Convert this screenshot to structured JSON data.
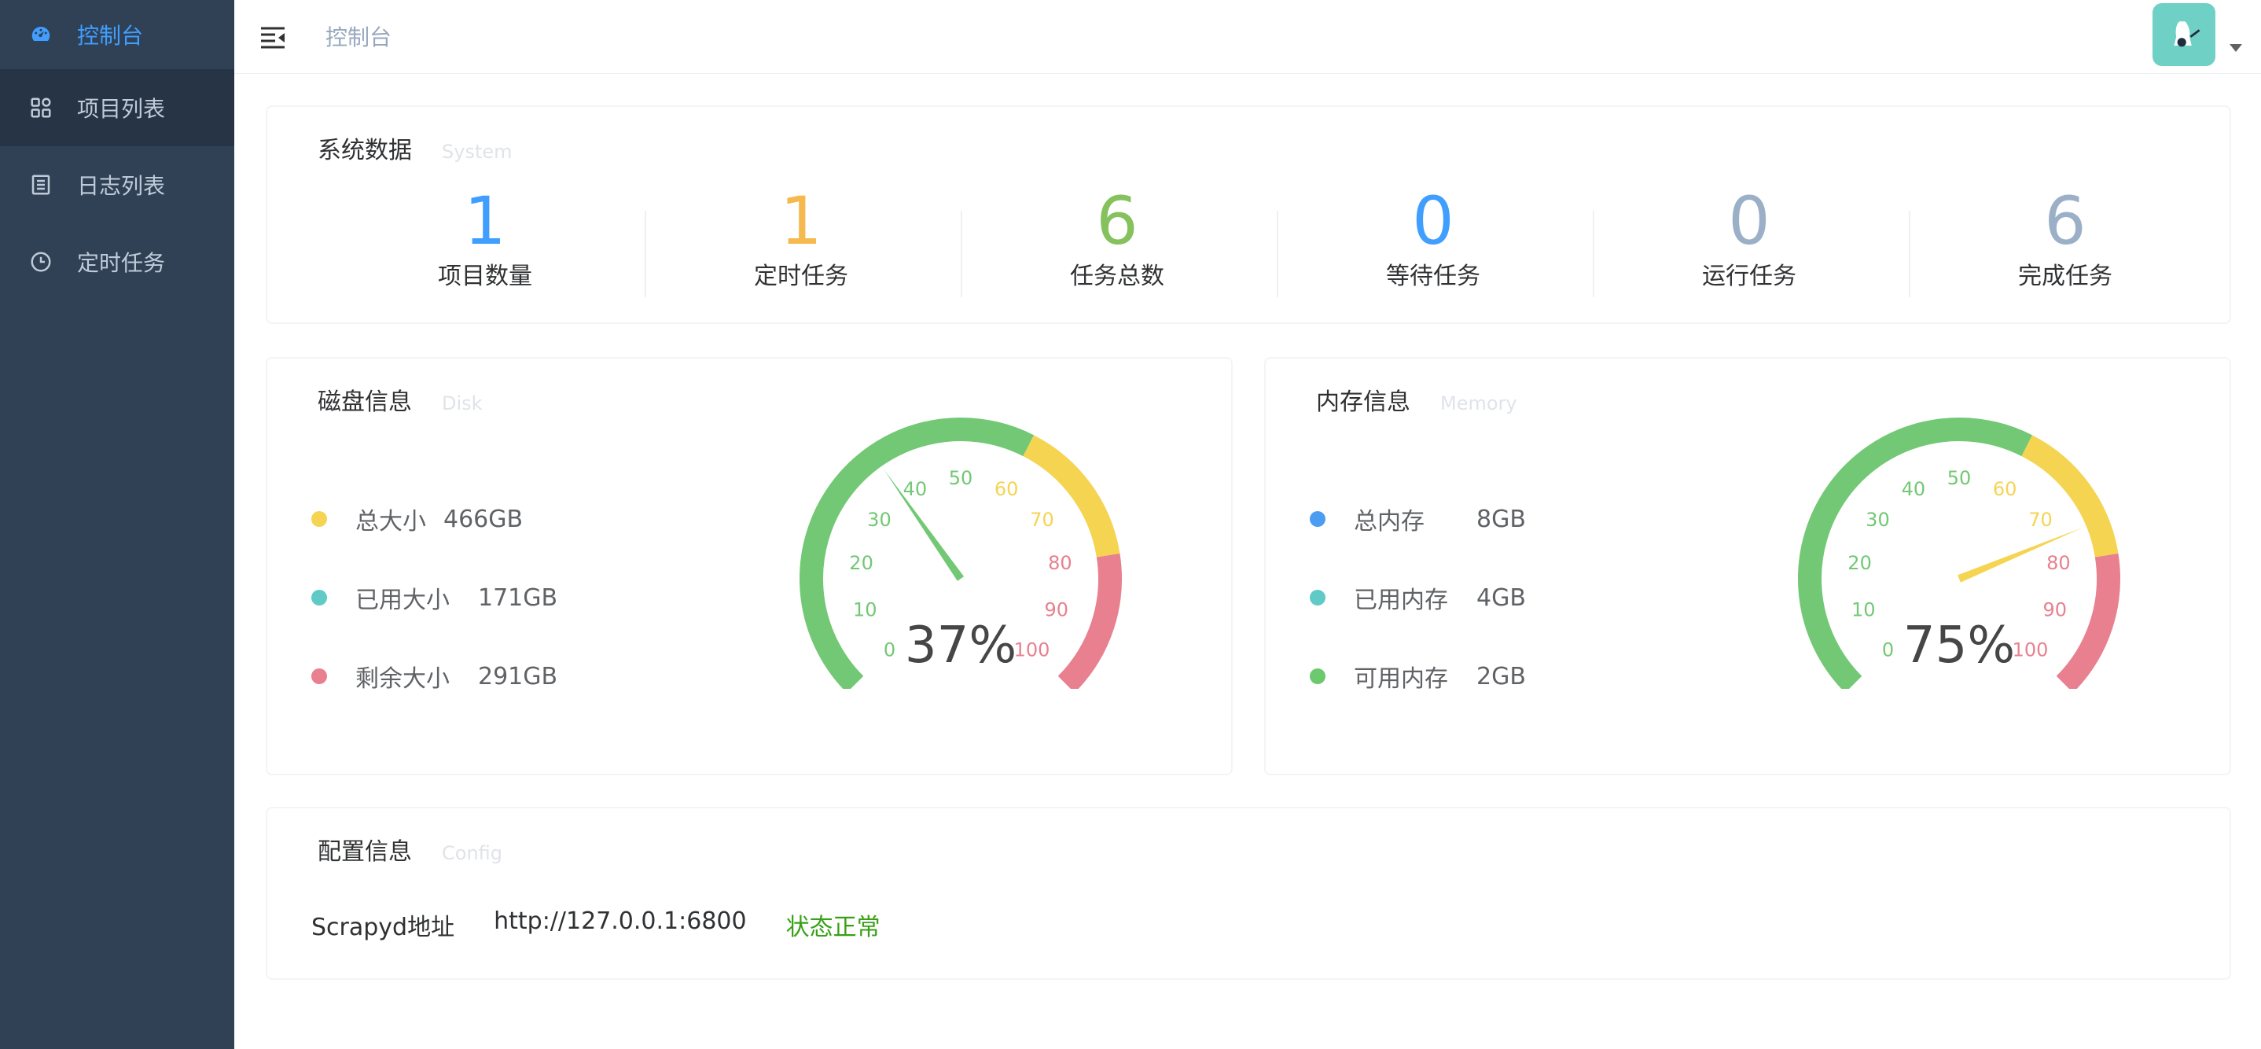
{
  "sidebar": {
    "items": [
      {
        "label": "控制台",
        "icon": "dashboard-icon"
      },
      {
        "label": "项目列表",
        "icon": "grid-icon"
      },
      {
        "label": "日志列表",
        "icon": "document-icon"
      },
      {
        "label": "定时任务",
        "icon": "clock-icon"
      }
    ],
    "active_color": "#409eff",
    "bg_color": "#304156"
  },
  "header": {
    "breadcrumb": "控制台"
  },
  "system": {
    "title": "系统数据",
    "subtitle": "System",
    "stats": [
      {
        "value": "1",
        "label": "项目数量",
        "color": "#409eff"
      },
      {
        "value": "1",
        "label": "定时任务",
        "color": "#f6b94e"
      },
      {
        "value": "6",
        "label": "任务总数",
        "color": "#85c25d"
      },
      {
        "value": "0",
        "label": "等待任务",
        "color": "#409eff"
      },
      {
        "value": "0",
        "label": "运行任务",
        "color": "#9bb0c7"
      },
      {
        "value": "6",
        "label": "完成任务",
        "color": "#9bb0c7"
      }
    ]
  },
  "disk": {
    "title": "磁盘信息",
    "subtitle": "Disk",
    "legend": [
      {
        "label": "总大小",
        "value": "466GB",
        "color": "#f5d452"
      },
      {
        "label": "已用大小",
        "value": "171GB",
        "color": "#5fcac6"
      },
      {
        "label": "剩余大小",
        "value": "291GB",
        "color": "#e8808f"
      }
    ],
    "gauge_percent": "37%",
    "gauge_value": 37
  },
  "memory": {
    "title": "内存信息",
    "subtitle": "Memory",
    "legend": [
      {
        "label": "总内存",
        "value": "8GB",
        "color": "#4a9df0"
      },
      {
        "label": "已用内存",
        "value": "4GB",
        "color": "#5fcac6"
      },
      {
        "label": "可用内存",
        "value": "2GB",
        "color": "#6cc96e"
      }
    ],
    "gauge_percent": "75%",
    "gauge_value": 75
  },
  "gauge": {
    "ticks": [
      "0",
      "10",
      "20",
      "30",
      "40",
      "50",
      "60",
      "70",
      "80",
      "90",
      "100"
    ],
    "colors": {
      "green": "#72c874",
      "yellow": "#f5d452",
      "red": "#e8808f"
    }
  },
  "config": {
    "title": "配置信息",
    "subtitle": "Config",
    "scrapyd_label": "Scrapyd地址",
    "scrapyd_url": "http://127.0.0.1:6800",
    "status": "状态正常"
  }
}
